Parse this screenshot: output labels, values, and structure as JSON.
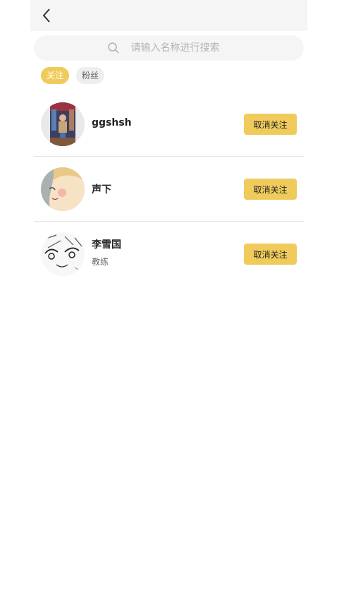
{
  "header": {
    "back_icon": "chevron-left-icon"
  },
  "search": {
    "placeholder": "请输入名称进行搜索",
    "icon": "search-icon"
  },
  "tabs": [
    {
      "label": "关注",
      "active": true
    },
    {
      "label": "粉丝",
      "active": false
    }
  ],
  "users": [
    {
      "name": "ggshsh",
      "subtitle": "",
      "action": "取消关注"
    },
    {
      "name": "声下",
      "subtitle": "",
      "action": "取消关注"
    },
    {
      "name": "李雪国",
      "subtitle": "教练",
      "action": "取消关注"
    }
  ],
  "colors": {
    "accent": "#f0cb5b",
    "header_bg": "#f5f5f5",
    "divider": "#e4e4e4"
  }
}
